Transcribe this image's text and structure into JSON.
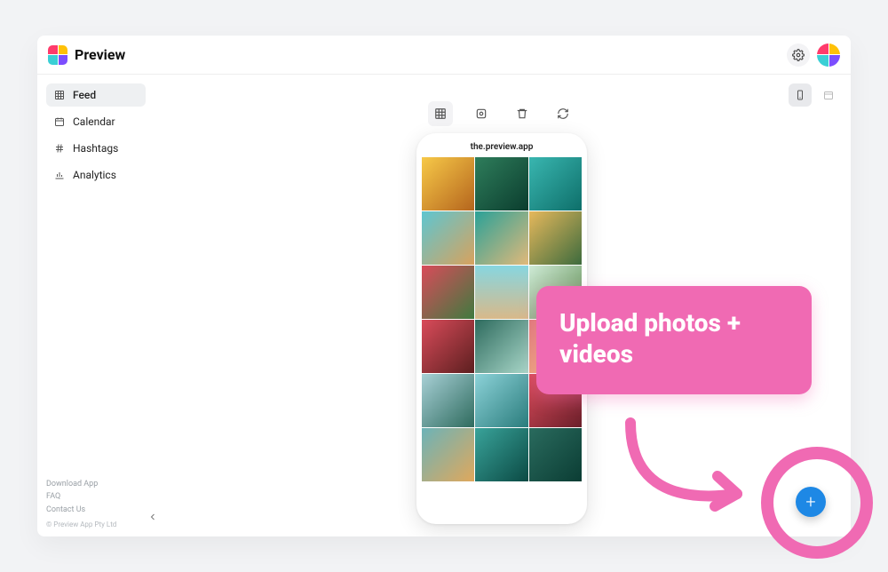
{
  "header": {
    "title": "Preview"
  },
  "sidebar": {
    "items": [
      {
        "label": "Feed",
        "icon": "grid",
        "active": true
      },
      {
        "label": "Calendar",
        "icon": "calendar",
        "active": false
      },
      {
        "label": "Hashtags",
        "icon": "hash",
        "active": false
      },
      {
        "label": "Analytics",
        "icon": "chart",
        "active": false
      }
    ],
    "footer_links": [
      "Download App",
      "FAQ",
      "Contact Us"
    ],
    "copyright": "© Preview App Pty Ltd"
  },
  "phone": {
    "username": "the.preview.app"
  },
  "annotation": {
    "text": "Upload photos + videos"
  },
  "colors": {
    "accent_pink": "#f06ab3",
    "fab_blue": "#1e88e5"
  }
}
